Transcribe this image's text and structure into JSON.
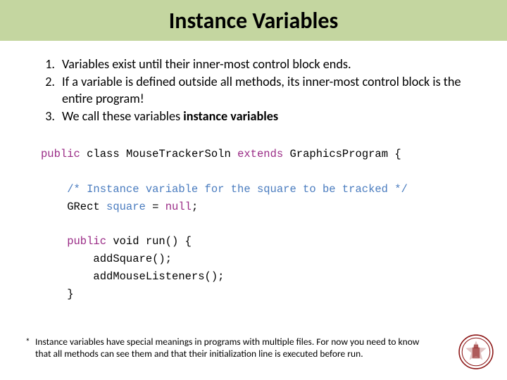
{
  "title": "Instance Variables",
  "list": {
    "items": [
      {
        "num": "1.",
        "text": "Variables exist until their inner-most control block ends."
      },
      {
        "num": "2.",
        "text": "If a variable is defined outside all methods, its inner-most control block is the entire program!"
      },
      {
        "num": "3.",
        "html": "We call these variables <b>instance variables</b>"
      }
    ]
  },
  "code": {
    "l1a": "public",
    "l1b": " class ",
    "l1c": "MouseTrackerSoln ",
    "l1d": "extends",
    "l1e": " GraphicsProgram {",
    "l2": "    /* Instance variable for the square to be tracked */",
    "l3a": "    GRect ",
    "l3b": "square",
    "l3c": " = ",
    "l3d": "null",
    "l3e": ";",
    "l4a": "    public",
    "l4b": " void ",
    "l4c": "run() {",
    "l5": "        addSquare();",
    "l6": "        addMouseListeners();",
    "l7": "    }"
  },
  "footnote": {
    "star": "*",
    "text": "Instance variables have special meanings in programs with multiple files. For now you need to know that all methods can see them and that their initialization line is executed before run."
  }
}
